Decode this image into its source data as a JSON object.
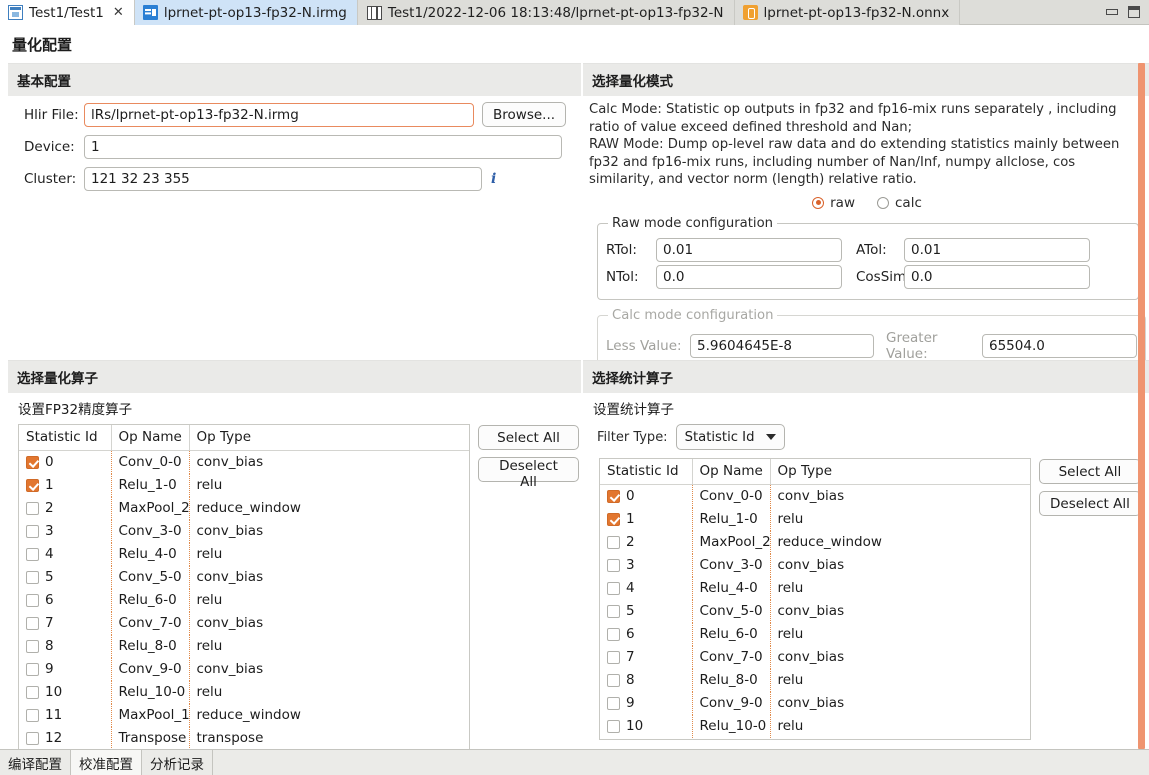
{
  "window": {
    "tabs": [
      {
        "label": "Test1/Test1",
        "icon": "window-icon",
        "state": "active",
        "closable": true
      },
      {
        "label": "lprnet-pt-op13-fp32-N.irmg",
        "icon": "file-icon",
        "state": "highlighted",
        "closable": false
      },
      {
        "label": "Test1/2022-12-06 18:13:48/lprnet-pt-op13-fp32-N",
        "icon": "film-icon",
        "state": "normal",
        "closable": false
      },
      {
        "label": "lprnet-pt-op13-fp32-N.onnx",
        "icon": "onnx-icon",
        "state": "normal",
        "closable": false
      }
    ],
    "controls": [
      "minimize-icon",
      "restore-icon"
    ]
  },
  "page_title": "量化配置",
  "basic": {
    "title": "基本配置",
    "hlir_label": "Hlir File:",
    "hlir_value": "lRs/lprnet-pt-op13-fp32-N.irmg",
    "browse_label": "Browse...",
    "device_label": "Device:",
    "device_value": "1",
    "cluster_label": "Cluster:",
    "cluster_value": "121 32 23 355",
    "info_icon": "i"
  },
  "mode": {
    "title": "选择量化模式",
    "description_lines": [
      "Calc Mode: Statistic op outputs in fp32 and fp16-mix runs separately , including",
      "ratio of value exceed defined threshold and Nan;",
      "RAW Mode: Dump op-level raw data and do extending statistics mainly between",
      "fp32 and fp16-mix runs, including number of Nan/Inf, numpy allclose, cos",
      "similarity, and vector norm (length) relative ratio."
    ],
    "options": [
      {
        "label": "raw",
        "selected": true
      },
      {
        "label": "calc",
        "selected": false
      }
    ],
    "raw_group": {
      "legend": "Raw mode configuration",
      "fields": [
        {
          "label": "RTol:",
          "value": "0.01"
        },
        {
          "label": "ATol:",
          "value": "0.01"
        },
        {
          "label": "NTol:",
          "value": "0.0"
        },
        {
          "label": "CosSim:",
          "value": "0.0"
        }
      ]
    },
    "calc_group": {
      "legend": "Calc mode configuration",
      "enabled": false,
      "fields": [
        {
          "label": "Less Value:",
          "value": "5.9604645E-8"
        },
        {
          "label": "Greater Value:",
          "value": "65504.0"
        }
      ]
    }
  },
  "quant_ops": {
    "title": "选择量化算子",
    "subtitle": "设置FP32精度算子",
    "columns": [
      "Statistic Id",
      "Op Name",
      "Op Type"
    ],
    "select_all_label": "Select All",
    "deselect_all_label": "Deselect All",
    "rows": [
      {
        "id": "0",
        "name": "Conv_0-0",
        "type": "conv_bias",
        "checked": true
      },
      {
        "id": "1",
        "name": "Relu_1-0",
        "type": "relu",
        "checked": true
      },
      {
        "id": "2",
        "name": "MaxPool_2",
        "type": "reduce_window",
        "checked": false
      },
      {
        "id": "3",
        "name": "Conv_3-0",
        "type": "conv_bias",
        "checked": false
      },
      {
        "id": "4",
        "name": "Relu_4-0",
        "type": "relu",
        "checked": false
      },
      {
        "id": "5",
        "name": "Conv_5-0",
        "type": "conv_bias",
        "checked": false
      },
      {
        "id": "6",
        "name": "Relu_6-0",
        "type": "relu",
        "checked": false
      },
      {
        "id": "7",
        "name": "Conv_7-0",
        "type": "conv_bias",
        "checked": false
      },
      {
        "id": "8",
        "name": "Relu_8-0",
        "type": "relu",
        "checked": false
      },
      {
        "id": "9",
        "name": "Conv_9-0",
        "type": "conv_bias",
        "checked": false
      },
      {
        "id": "10",
        "name": "Relu_10-0",
        "type": "relu",
        "checked": false
      },
      {
        "id": "11",
        "name": "MaxPool_1",
        "type": "reduce_window",
        "checked": false
      },
      {
        "id": "12",
        "name": "Transpose",
        "type": "transpose",
        "checked": false
      }
    ]
  },
  "stat_ops": {
    "title": "选择统计算子",
    "subtitle": "设置统计算子",
    "filter_label": "Filter Type:",
    "filter_value": "Statistic Id",
    "columns": [
      "Statistic Id",
      "Op Name",
      "Op Type"
    ],
    "select_all_label": "Select All",
    "deselect_all_label": "Deselect All",
    "rows": [
      {
        "id": "0",
        "name": "Conv_0-0",
        "type": "conv_bias",
        "checked": true
      },
      {
        "id": "1",
        "name": "Relu_1-0",
        "type": "relu",
        "checked": true
      },
      {
        "id": "2",
        "name": "MaxPool_2",
        "type": "reduce_window",
        "checked": false
      },
      {
        "id": "3",
        "name": "Conv_3-0",
        "type": "conv_bias",
        "checked": false
      },
      {
        "id": "4",
        "name": "Relu_4-0",
        "type": "relu",
        "checked": false
      },
      {
        "id": "5",
        "name": "Conv_5-0",
        "type": "conv_bias",
        "checked": false
      },
      {
        "id": "6",
        "name": "Relu_6-0",
        "type": "relu",
        "checked": false
      },
      {
        "id": "7",
        "name": "Conv_7-0",
        "type": "conv_bias",
        "checked": false
      },
      {
        "id": "8",
        "name": "Relu_8-0",
        "type": "relu",
        "checked": false
      },
      {
        "id": "9",
        "name": "Conv_9-0",
        "type": "conv_bias",
        "checked": false
      },
      {
        "id": "10",
        "name": "Relu_10-0",
        "type": "relu",
        "checked": false
      }
    ]
  },
  "bottom_tabs": [
    {
      "label": "编译配置",
      "active": false
    },
    {
      "label": "校准配置",
      "active": true
    },
    {
      "label": "分析记录",
      "active": false
    }
  ],
  "colors": {
    "accent": "#e2762f",
    "scrollbar": "#ef9470",
    "focus_border": "#e98a5e",
    "panel_header": "#eaeae8",
    "tab_highlight": "#cfe3f7"
  }
}
